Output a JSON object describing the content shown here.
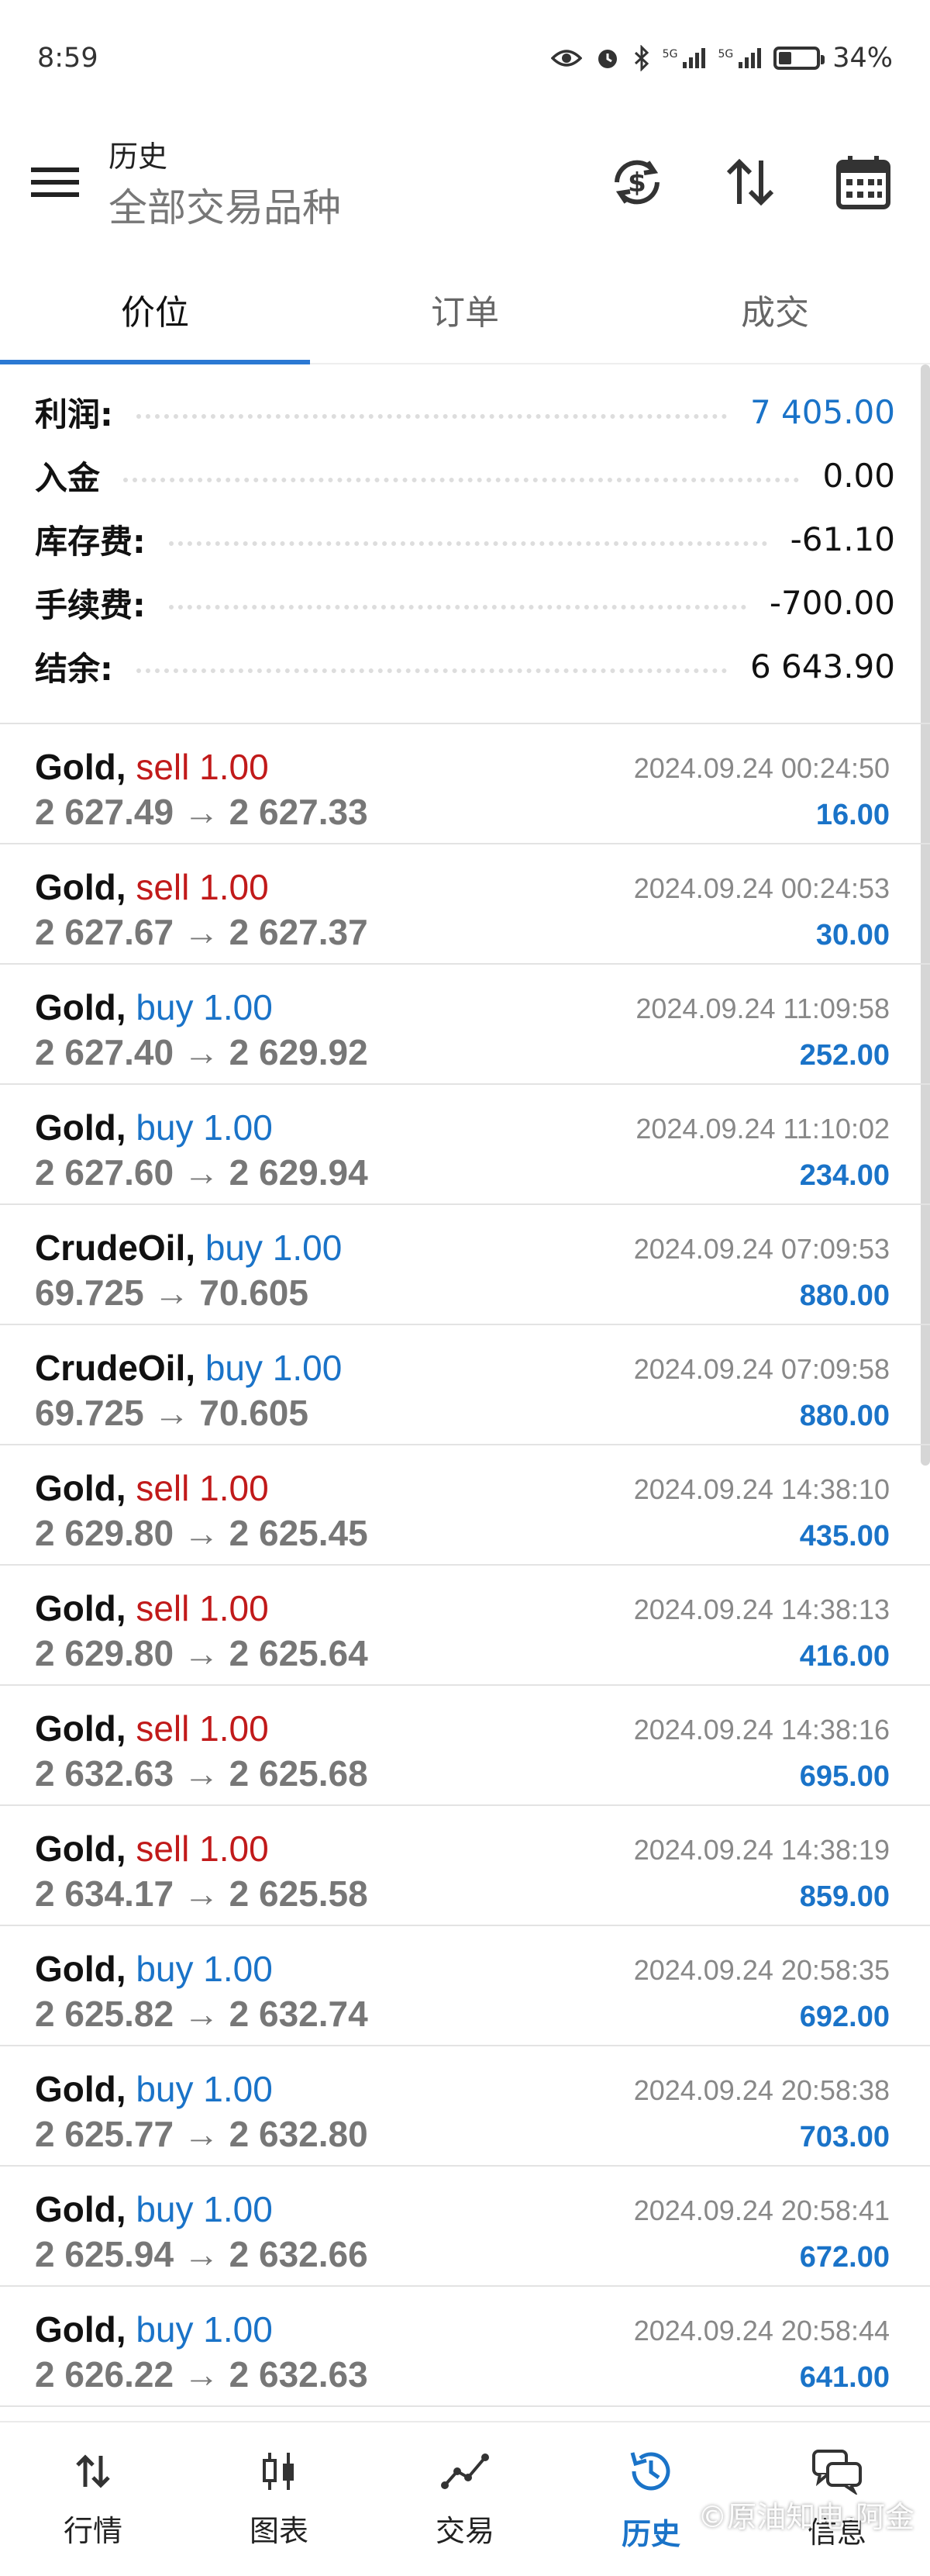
{
  "status": {
    "time": "8:59",
    "battery": "34%"
  },
  "header": {
    "title": "历史",
    "subtitle": "全部交易品种"
  },
  "tabs": [
    {
      "label": "价位",
      "active": true
    },
    {
      "label": "订单",
      "active": false
    },
    {
      "label": "成交",
      "active": false
    }
  ],
  "summary": [
    {
      "label": "利润:",
      "value": "7 405.00",
      "highlight": true
    },
    {
      "label": "入金",
      "value": "0.00",
      "highlight": false
    },
    {
      "label": "库存费:",
      "value": "-61.10",
      "highlight": false
    },
    {
      "label": "手续费:",
      "value": "-700.00",
      "highlight": false
    },
    {
      "label": "结余:",
      "value": "6 643.90",
      "highlight": false
    }
  ],
  "trades": [
    {
      "symbol": "Gold,",
      "direction": "sell",
      "volume": "1.00",
      "prices": "2 627.49 → 2 627.33",
      "time": "2024.09.24 00:24:50",
      "profit": "16.00"
    },
    {
      "symbol": "Gold,",
      "direction": "sell",
      "volume": "1.00",
      "prices": "2 627.67 → 2 627.37",
      "time": "2024.09.24 00:24:53",
      "profit": "30.00"
    },
    {
      "symbol": "Gold,",
      "direction": "buy",
      "volume": "1.00",
      "prices": "2 627.40 → 2 629.92",
      "time": "2024.09.24 11:09:58",
      "profit": "252.00"
    },
    {
      "symbol": "Gold,",
      "direction": "buy",
      "volume": "1.00",
      "prices": "2 627.60 → 2 629.94",
      "time": "2024.09.24 11:10:02",
      "profit": "234.00"
    },
    {
      "symbol": "CrudeOil,",
      "direction": "buy",
      "volume": "1.00",
      "prices": "69.725 → 70.605",
      "time": "2024.09.24 07:09:53",
      "profit": "880.00"
    },
    {
      "symbol": "CrudeOil,",
      "direction": "buy",
      "volume": "1.00",
      "prices": "69.725 → 70.605",
      "time": "2024.09.24 07:09:58",
      "profit": "880.00"
    },
    {
      "symbol": "Gold,",
      "direction": "sell",
      "volume": "1.00",
      "prices": "2 629.80 → 2 625.45",
      "time": "2024.09.24 14:38:10",
      "profit": "435.00"
    },
    {
      "symbol": "Gold,",
      "direction": "sell",
      "volume": "1.00",
      "prices": "2 629.80 → 2 625.64",
      "time": "2024.09.24 14:38:13",
      "profit": "416.00"
    },
    {
      "symbol": "Gold,",
      "direction": "sell",
      "volume": "1.00",
      "prices": "2 632.63 → 2 625.68",
      "time": "2024.09.24 14:38:16",
      "profit": "695.00"
    },
    {
      "symbol": "Gold,",
      "direction": "sell",
      "volume": "1.00",
      "prices": "2 634.17 → 2 625.58",
      "time": "2024.09.24 14:38:19",
      "profit": "859.00"
    },
    {
      "symbol": "Gold,",
      "direction": "buy",
      "volume": "1.00",
      "prices": "2 625.82 → 2 632.74",
      "time": "2024.09.24 20:58:35",
      "profit": "692.00"
    },
    {
      "symbol": "Gold,",
      "direction": "buy",
      "volume": "1.00",
      "prices": "2 625.77 → 2 632.80",
      "time": "2024.09.24 20:58:38",
      "profit": "703.00"
    },
    {
      "symbol": "Gold,",
      "direction": "buy",
      "volume": "1.00",
      "prices": "2 625.94 → 2 632.66",
      "time": "2024.09.24 20:58:41",
      "profit": "672.00"
    },
    {
      "symbol": "Gold,",
      "direction": "buy",
      "volume": "1.00",
      "prices": "2 626.22 → 2 632.63",
      "time": "2024.09.24 20:58:44",
      "profit": "641.00"
    }
  ],
  "nav": [
    {
      "label": "行情",
      "icon": "quotes-icon",
      "active": false
    },
    {
      "label": "图表",
      "icon": "chart-icon",
      "active": false
    },
    {
      "label": "交易",
      "icon": "trade-icon",
      "active": false
    },
    {
      "label": "历史",
      "icon": "history-icon",
      "active": true
    },
    {
      "label": "信息",
      "icon": "messages-icon",
      "active": false
    }
  ],
  "watermark": "©原油知电-阿金",
  "colors": {
    "accent": "#1a73c8",
    "sell": "#c11a1a",
    "tab_indicator": "#2b79d3"
  }
}
